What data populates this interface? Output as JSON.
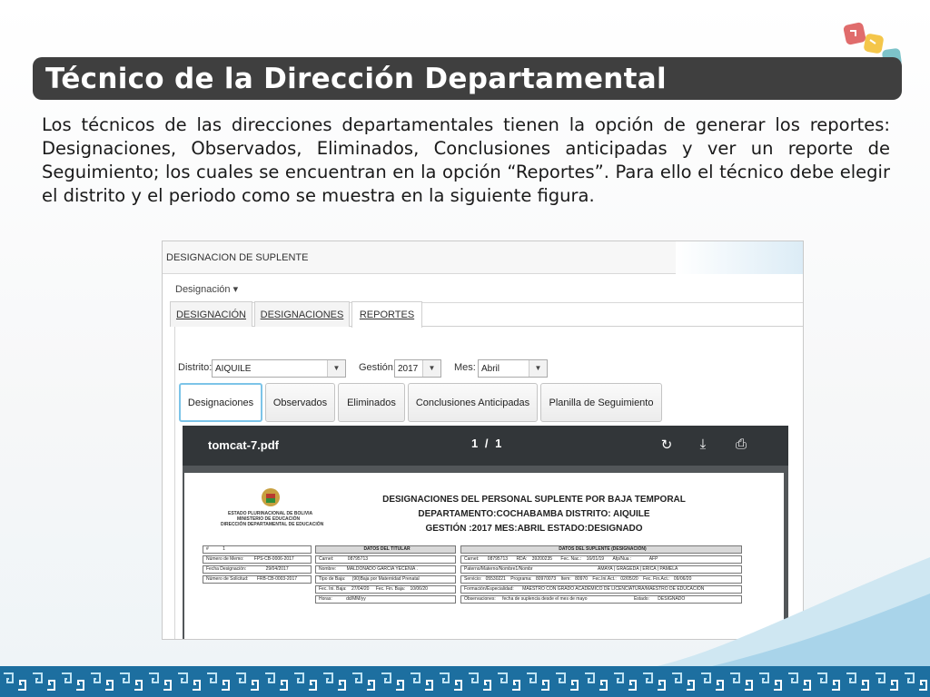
{
  "slide": {
    "title": "Técnico de la Dirección Departamental",
    "body": "Los técnicos de las direcciones departamentales tienen la opción de generar los reportes: Designaciones, Observados, Eliminados, Conclusiones anticipadas y ver un reporte de Seguimiento; los cuales se encuentran en la opción “Reportes”. Para ello el técnico debe elegir el distrito y el periodo como se muestra en la siguiente figura."
  },
  "app": {
    "header": "DESIGNACION DE SUPLENTE",
    "menu": "Designación ▾",
    "tabs": [
      "DESIGNACIÓN",
      "DESIGNACIONES",
      "REPORTES"
    ],
    "active_tab": "REPORTES",
    "filters": {
      "distrito_label": "Distrito:",
      "distrito_value": "AIQUILE",
      "gestion_label": "Gestión:",
      "gestion_value": "2017",
      "mes_label": "Mes:",
      "mes_value": "Abril"
    },
    "buttons": [
      "Designaciones",
      "Observados",
      "Eliminados",
      "Conclusiones Anticipadas",
      "Planilla de Seguimiento"
    ]
  },
  "viewer": {
    "filename": "tomcat-7.pdf",
    "page": "1",
    "page_sep": "/",
    "total": "1",
    "icons": [
      "rotate-icon",
      "download-icon",
      "print-icon"
    ]
  },
  "pdf": {
    "org_lines": [
      "ESTADO PLURINACIONAL DE BOLIVIA",
      "MINISTERIO DE EDUCACIÓN",
      "DIRECCIÓN DEPARTAMENTAL DE EDUCACIÓN"
    ],
    "title1": "DESIGNACIONES DEL PERSONAL SUPLENTE POR BAJA TEMPORAL",
    "title2": "DEPARTAMENTO:COCHABAMBA  DISTRITO: AIQUILE",
    "title3": "GESTIÓN :2017  MES:ABRIL  ESTADO:DESIGNADO",
    "left_rows": [
      [
        "#",
        "1"
      ],
      [
        "Número de Memo:",
        "FPS-CB-0006-2017"
      ],
      [
        "Fecha Designación:",
        "29/04/2017"
      ],
      [
        "Número de Solicitud:",
        "FRB-CB-0003-2017"
      ]
    ],
    "titular_header": "DATOS DEL TITULAR",
    "titular_rows": [
      [
        "Carnet:",
        "08795713"
      ],
      [
        "Nombre:",
        "MALDONADO GARCIA YECENIA ."
      ],
      [
        "Tipo de Baja:",
        "(90)Baja por Maternidad Prenatal"
      ],
      [
        "Fec. Ini. Baja:",
        "27/04/20",
        "Fec. Fin. Baja:",
        "10/06/20"
      ],
      [
        "Horas:",
        "dd/MM/yy"
      ]
    ],
    "suplente_header": "DATOS DEL SUPLENTE (DESIGNACIÓN)",
    "suplente_rows": [
      [
        "Carnet:",
        "08795713",
        "RDA:",
        "39200235",
        "Fec. Nac.:",
        "16/01/19",
        "Afp/Nua :",
        "AFP"
      ],
      [
        "Paterno/Materno/Nombre1/Nombr",
        "AMAYA | GRAGEDA | ERICA | PAMELA"
      ],
      [
        "Servicio:",
        "05530221",
        "Programa:",
        "80970073",
        "Item:",
        "80970",
        "Fec.Ini.Act.:",
        "02/05/20",
        "Fec. Fin.Act.:",
        "09/06/20"
      ],
      [
        "Formación/Especialidad:",
        "MAESTRO CON GRADO ACADÉMICO DE LICENCIATURA/MAESTRO DE EDUCACIÓN"
      ],
      [
        "Observaciones:",
        "fecha de suplencia desde el mes de mayo",
        "Estado:",
        "DESIGNADO"
      ]
    ]
  }
}
